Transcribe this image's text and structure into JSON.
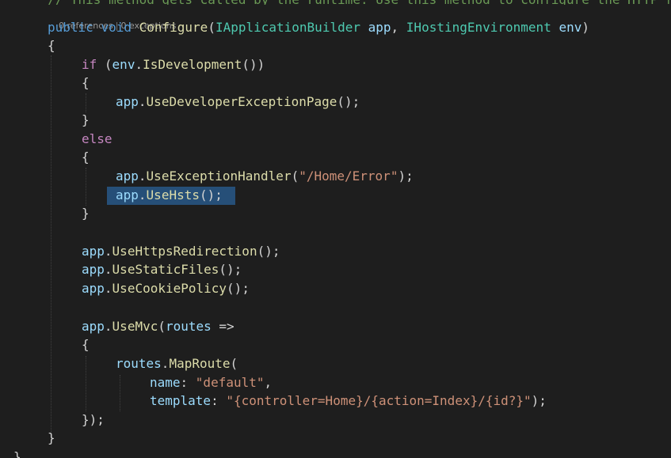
{
  "codelens": {
    "references": "0 references",
    "separator": "|",
    "exceptions": "0 exceptions"
  },
  "code": {
    "sig": {
      "kw1": "public",
      "kw2": "void",
      "name": "Configure",
      "p1type": "IApplicationBuilder",
      "p1": "app",
      "p2type": "IHostingEnvironment",
      "p2": "env"
    },
    "brace_open": "{",
    "brace_close": "}",
    "if_kw": "if",
    "if_obj": "env",
    "if_method": "IsDevelopment",
    "dev_page": "UseDeveloperExceptionPage",
    "else_kw": "else",
    "exc_handler": "UseExceptionHandler",
    "exc_path": "\"/Home/Error\"",
    "hsts": "UseHsts",
    "https_redirect": "UseHttpsRedirection",
    "static_files": "UseStaticFiles",
    "cookie_policy": "UseCookiePolicy",
    "use_mvc": "UseMvc",
    "routes_param": "routes",
    "arrow": "=>",
    "map_route": "MapRoute",
    "name_param": "name",
    "name_value": "\"default\"",
    "template_param": "template",
    "template_value": "\"{controller=Home}/{action=Index}/{id?}\"",
    "app": "app",
    "routes": "routes"
  }
}
